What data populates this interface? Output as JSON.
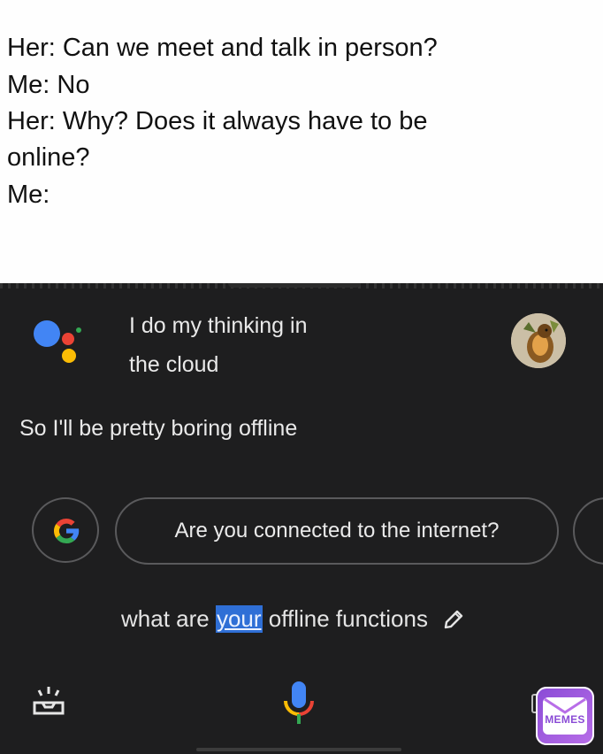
{
  "caption": {
    "lines": [
      "Her: Can we meet and talk in person?",
      "Me: No",
      "Her: Why? Does it always have to be",
      "online?",
      "Me:"
    ]
  },
  "assistant": {
    "reply_line1": "I do my thinking in",
    "reply_line2": "the cloud",
    "followup": "So I'll be pretty boring offline",
    "suggestion": "Are you connected to the internet?"
  },
  "query": {
    "before": "what are ",
    "highlighted": "your",
    "after": " offline functions"
  },
  "icons": {
    "logo": "google-assistant-icon",
    "google": "google-g-icon",
    "edit": "pencil-icon",
    "explore": "explore-tray-icon",
    "mic": "microphone-icon",
    "avatar": "user-avatar"
  },
  "watermark": {
    "label": "MEMES"
  },
  "colors": {
    "background": "#1e1e1f",
    "highlight": "#2f6fd6",
    "google_blue": "#4285F4",
    "google_red": "#EA4335",
    "google_yellow": "#FBBC05",
    "google_green": "#34A853"
  }
}
